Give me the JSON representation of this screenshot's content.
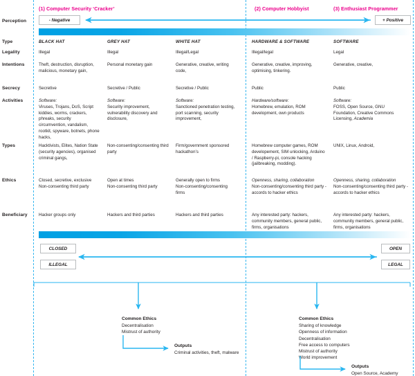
{
  "perception": {
    "row_label": "Perception",
    "negative_label": "- Negative",
    "positive_label": "+ Positive"
  },
  "columns": [
    {
      "id": "cracker",
      "label": "(1) Computer Security ‘Cracker’"
    },
    {
      "id": "hobbyist",
      "label": "(2) Computer Hobbyist"
    },
    {
      "id": "programmer",
      "label": "(3) Enthusiast Programmer"
    }
  ],
  "row_labels": [
    "Type",
    "Legality",
    "Intentions",
    "Secrecy",
    "Activities",
    "Types",
    "Ethics",
    "Beneficiary"
  ],
  "cells": {
    "type": [
      "BLACK HAT",
      "GREY HAT",
      "WHITE HAT",
      "HARDWARE & SOFTWARE",
      "SOFTWARE"
    ],
    "legality": [
      "Illegal",
      "Illegal",
      "Illegal/Legal",
      "Illegal/legal",
      "Legal"
    ],
    "intentions": [
      "Theft, destruction, disruption, malicious, monetary gain,",
      "Personal monetary gain",
      "Generative, creative, writing code,",
      "Generative, creative, improving, optimising, tinkering.",
      "Generative, creative,"
    ],
    "secrecy": [
      "Secretive",
      "Secretive / Public",
      "Secretive / Public",
      "Public",
      "Public"
    ],
    "activities": [
      {
        "lead": "Software:",
        "body": "Viruses, Trojans, DoS, Script kiddies, worms, crackers, phreaks, security circumvention, vandalism, rootkit, spyware, botnets, phone hacks,"
      },
      {
        "lead": "Software:",
        "body": "Security improvement, vulnerability discovery and disclosure,"
      },
      {
        "lead": "Software:",
        "body": "Sanctioned penetration testing, port scanning, security improvement,"
      },
      {
        "lead": "Hardware/software:",
        "body": "Homebrew, emulation, ROM development, own products"
      },
      {
        "lead": "Software:",
        "body": "FOSS, Open Source, GNU Foundation, Creative Commons Licensing, ",
        "tail_italic": "Academia"
      }
    ],
    "types": [
      "Hacktivists, Elites, Nation State (security agencies), organised criminal gangs,",
      "Non-consenting/consenting third party",
      "Firm/government sponsored hackathon’s",
      "Homebrew computer games, ROM developement, SIM unlocking, Arduino / Raspberry-pi, console hacking (jailbreaking, modding).",
      "UNIX, Linux, Android,"
    ],
    "ethics": [
      {
        "l1": "Closed, secretive, exclusive",
        "l2": "Non-consenting third party",
        "italic_first": false
      },
      {
        "l1": "Open at times",
        "l2": "Non-consenting third party",
        "italic_first": false
      },
      {
        "l1": "Generally open to firms",
        "l2": "Non-consenting/consenting firms",
        "italic_first": false
      },
      {
        "l1": "Openness, sharing, collaboration",
        "l2": "Non-consenting/consenting third party - accords to hacker ethics",
        "italic_first": true
      },
      {
        "l1": "Openness, sharing, collaboration",
        "l2": "Non-consenting/consenting third party - accords to hacker ethics",
        "italic_first": true
      }
    ],
    "beneficiary": [
      "Hacker groups only",
      "Hackers and third parties",
      "Hackers and third parties",
      "Any interested party: hackers, community members, general public, firms, organisations",
      "Any interested party: hackers, community members, general public, firms, organisations"
    ]
  },
  "axis": {
    "closed": "CLOSED",
    "open": "OPEN",
    "illegal": "ILLEGAL",
    "legal": "LEGAL"
  },
  "bottom": {
    "left": {
      "ethics_title": "Common Ethics",
      "ethics_items": [
        "Decentralisation",
        "Mistrust of authority"
      ],
      "outputs_title": "Outputs",
      "outputs_text": "Criminal activities, theft,  malware"
    },
    "right": {
      "ethics_title": "Common Ethics",
      "ethics_items": [
        "Sharing of knowledge",
        "Openness of information",
        "Decentralisation",
        "Free access to computers",
        "Mistrust of authority",
        "World improvement"
      ],
      "outputs_title": "Outputs",
      "outputs_text": "Open Source, Academy"
    }
  },
  "colors": {
    "accent_blue": "#29b6f0",
    "header_pink": "#ec008c",
    "text": "#231f20",
    "pill_border": "#b9bcbe"
  }
}
